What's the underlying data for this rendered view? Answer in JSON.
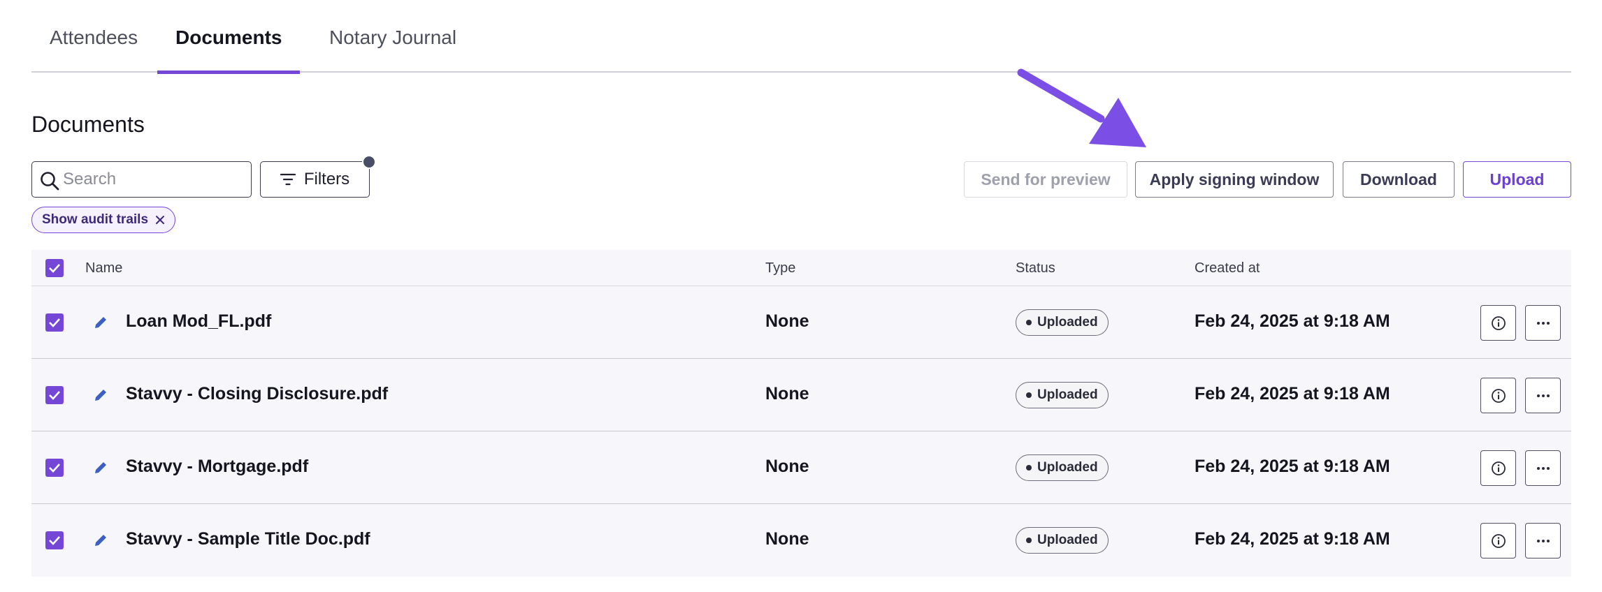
{
  "tabs": [
    {
      "label": "Attendees"
    },
    {
      "label": "Documents"
    },
    {
      "label": "Notary Journal"
    }
  ],
  "section_title": "Documents",
  "search": {
    "placeholder": "Search",
    "value": ""
  },
  "filters": {
    "label": "Filters"
  },
  "chip": {
    "label": "Show audit trails"
  },
  "actions": {
    "send_preview": "Send for preview",
    "apply_window": "Apply signing window",
    "download": "Download",
    "upload": "Upload"
  },
  "table": {
    "headers": {
      "name": "Name",
      "type": "Type",
      "status": "Status",
      "created": "Created at"
    },
    "rows": [
      {
        "name": "Loan Mod_FL.pdf",
        "type": "None",
        "status": "Uploaded",
        "created": "Feb 24, 2025 at 9:18 AM"
      },
      {
        "name": "Stavvy - Closing Disclosure.pdf",
        "type": "None",
        "status": "Uploaded",
        "created": "Feb 24, 2025 at 9:18 AM"
      },
      {
        "name": "Stavvy - Mortgage.pdf",
        "type": "None",
        "status": "Uploaded",
        "created": "Feb 24, 2025 at 9:18 AM"
      },
      {
        "name": "Stavvy - Sample Title Doc.pdf",
        "type": "None",
        "status": "Uploaded",
        "created": "Feb 24, 2025 at 9:18 AM"
      }
    ]
  },
  "colors": {
    "accent": "#7447d6",
    "arrow": "#7b4fe6"
  }
}
